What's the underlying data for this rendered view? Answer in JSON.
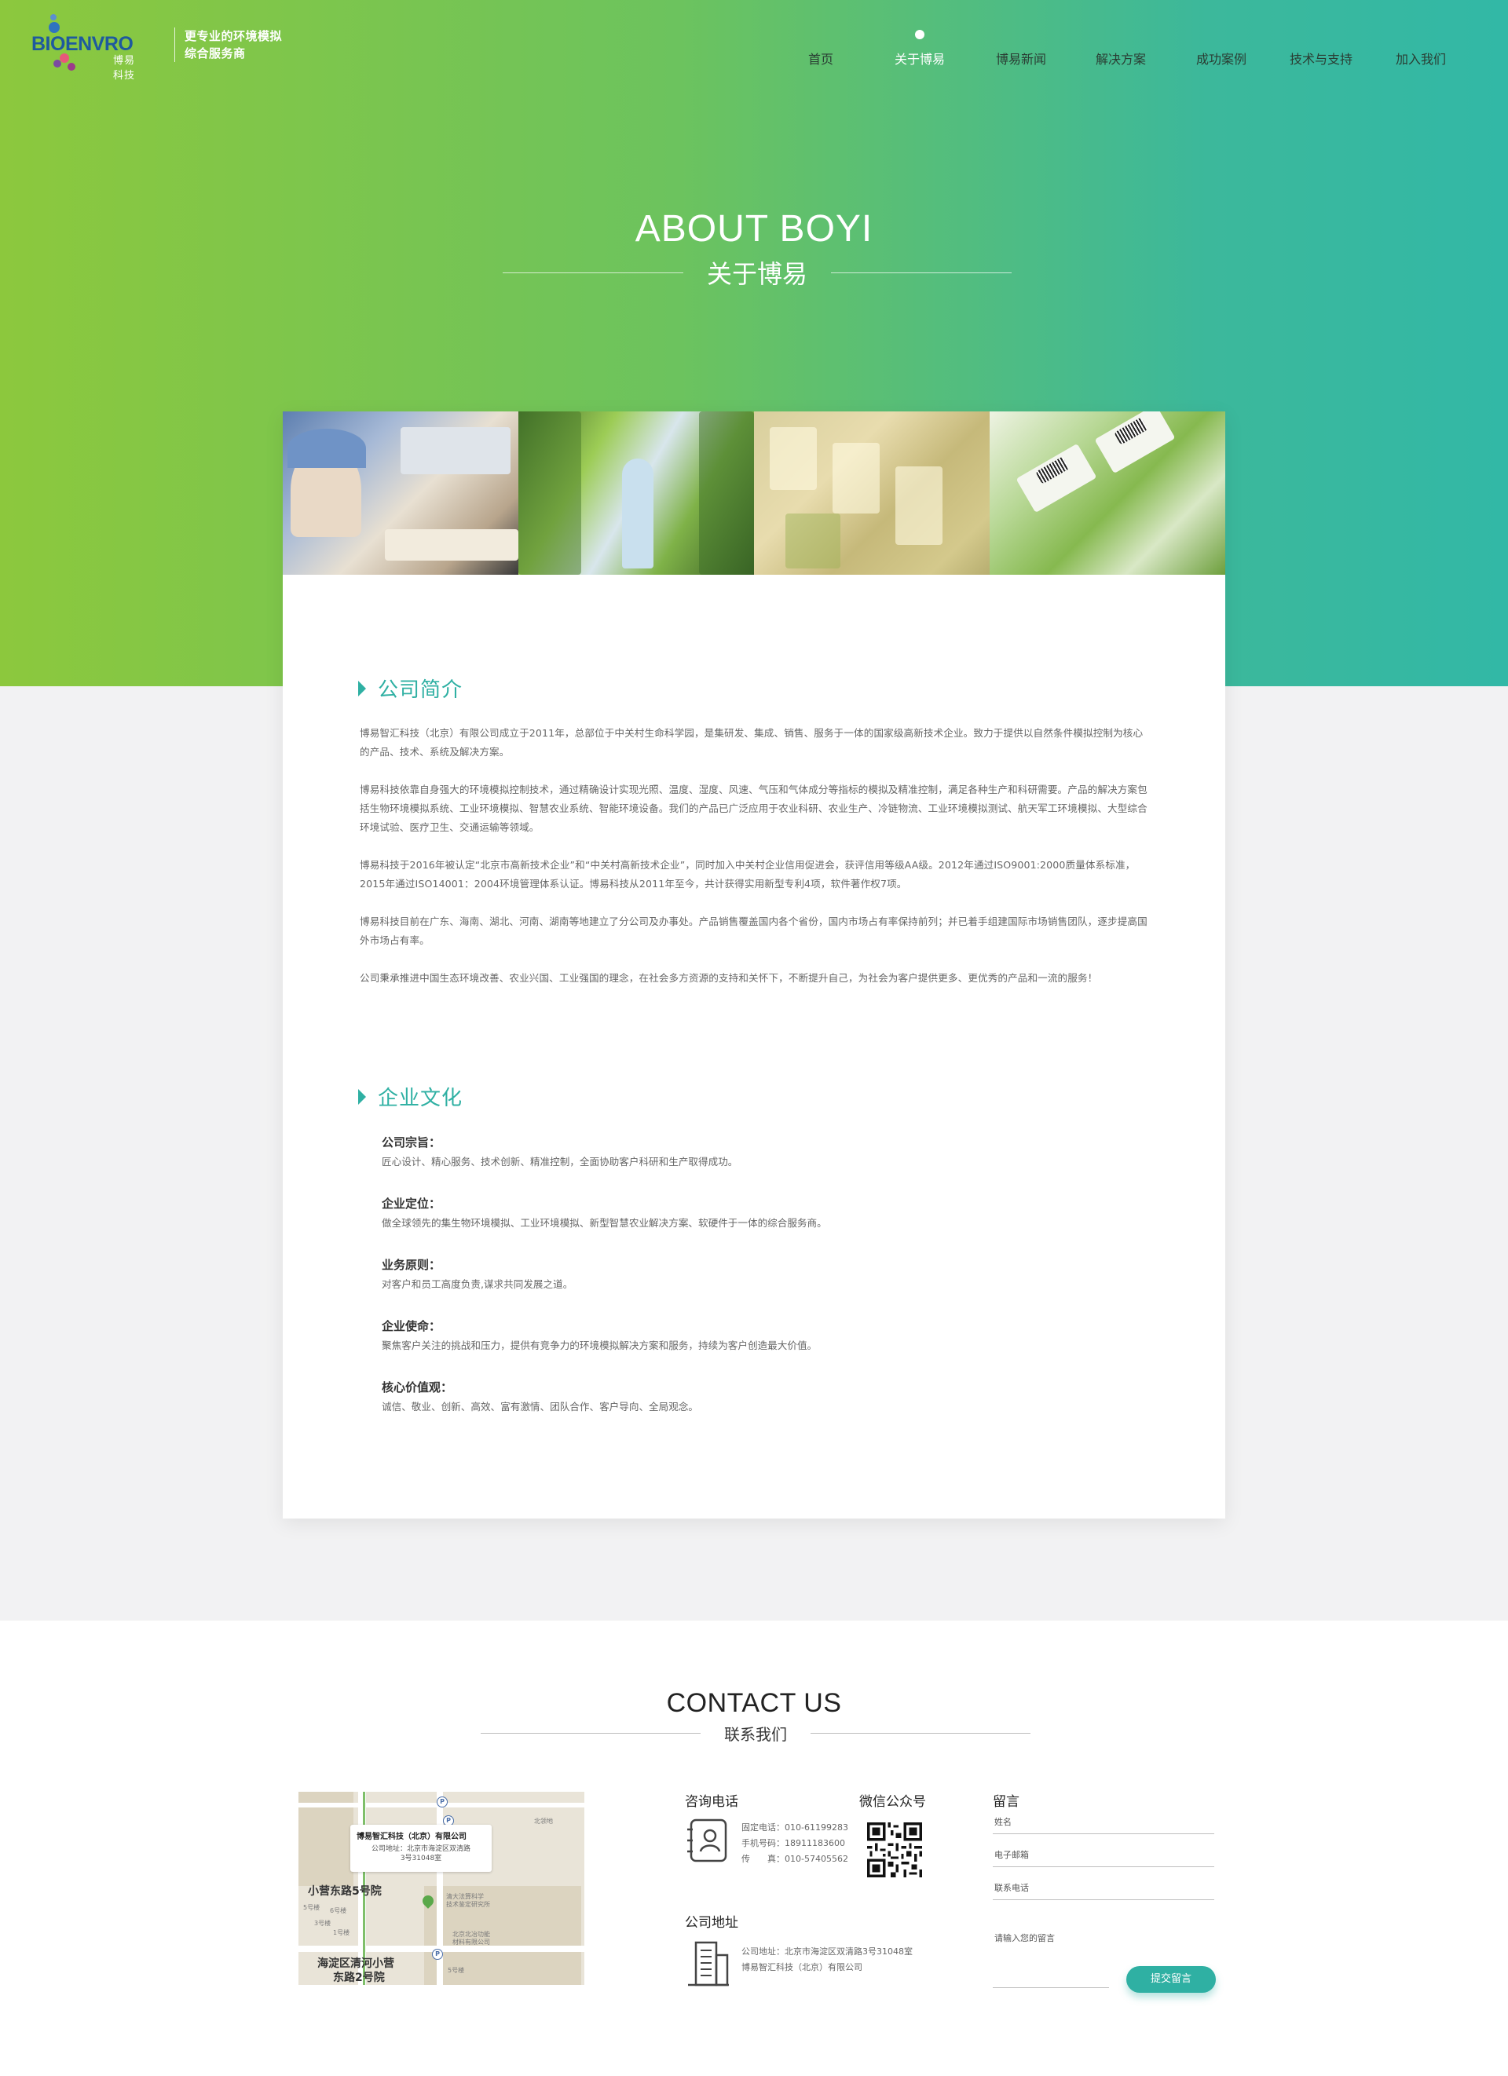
{
  "brand": {
    "logo_text": "BIOENVRO",
    "logo_cn": "博易科技",
    "slogan_line1": "更专业的环境模拟",
    "slogan_line2": "综合服务商"
  },
  "nav": {
    "items": [
      {
        "label": "首页"
      },
      {
        "label": "关于博易"
      },
      {
        "label": "博易新闻"
      },
      {
        "label": "解决方案"
      },
      {
        "label": "成功案例"
      },
      {
        "label": "技术与支持"
      },
      {
        "label": "加入我们"
      }
    ],
    "active_index": 1
  },
  "hero": {
    "title": "ABOUT BOYI",
    "subtitle": "关于博易"
  },
  "intro": {
    "heading": "公司简介",
    "paragraphs": [
      "博易智汇科技（北京）有限公司成立于2011年，总部位于中关村生命科学园，是集研发、集成、销售、服务于一体的国家级高新技术企业。致力于提供以自然条件模拟控制为核心的产品、技术、系统及解决方案。",
      "博易科技依靠自身强大的环境模拟控制技术，通过精确设计实现光照、温度、湿度、风速、气压和气体成分等指标的模拟及精准控制，满足各种生产和科研需要。产品的解决方案包括生物环境模拟系统、工业环境模拟、智慧农业系统、智能环境设备。我们的产品已广泛应用于农业科研、农业生产、冷链物流、工业环境模拟测试、航天军工环境模拟、大型综合环境试验、医疗卫生、交通运输等领域。",
      "博易科技于2016年被认定“北京市高新技术企业”和“中关村高新技术企业”，同时加入中关村企业信用促进会，获评信用等级AA级。2012年通过ISO9001:2000质量体系标准，2015年通过ISO14001：2004环境管理体系认证。博易科技从2011年至今，共计获得实用新型专利4项，软件著作权7项。",
      "博易科技目前在广东、海南、湖北、河南、湖南等地建立了分公司及办事处。产品销售覆盖国内各个省份，国内市场占有率保持前列；并已着手组建国际市场销售团队，逐步提高国外市场占有率。",
      "公司秉承推进中国生态环境改善、农业兴国、工业强国的理念，在社会多方资源的支持和关怀下，不断提升自己，为社会为客户提供更多、更优秀的产品和一流的服务！"
    ]
  },
  "culture": {
    "heading": "企业文化",
    "items": [
      {
        "title": "公司宗旨：",
        "text": "匠心设计、精心服务、技术创新、精准控制，全面协助客户科研和生产取得成功。"
      },
      {
        "title": "企业定位：",
        "text": "做全球领先的集生物环境模拟、工业环境模拟、新型智慧农业解决方案、软硬件于一体的综合服务商。"
      },
      {
        "title": "业务原则：",
        "text": "对客户和员工高度负责,谋求共同发展之道。"
      },
      {
        "title": "企业使命：",
        "text": "聚焦客户关注的挑战和压力，提供有竞争力的环境模拟解决方案和服务，持续为客户创造最大价值。"
      },
      {
        "title": "核心价值观：",
        "text": "诚信、敬业、创新、高效、富有激情、团队合作、客户导向、全局观念。"
      }
    ]
  },
  "contact": {
    "title": "CONTACT US",
    "subtitle": "联系我们",
    "map": {
      "popup_title": "博易智汇科技（北京）有限公司",
      "popup_addr1": "公司地址：北京市海淀区双清路",
      "popup_addr2": "3号31048室",
      "label_a": "小营东路5号院",
      "label_b": "海淀区清河小营",
      "label_c": "东路2号院",
      "poi_1": "北领地",
      "poi_2": "清大法算科学",
      "poi_3": "技术鉴定研究所",
      "poi_4": "北京北冶功能",
      "poi_5": "材料有限公司",
      "bldg_1": "5号楼",
      "bldg_2": "6号楼",
      "bldg_3": "3号楼",
      "bldg_4": "1号楼",
      "bldg_5": "5号楼"
    },
    "phone": {
      "title": "咨询电话",
      "landline": "固定电话：010-61199283",
      "mobile": "手机号码：18911183600",
      "fax": "传　　真：010-57405562"
    },
    "wechat": {
      "title": "微信公众号"
    },
    "address": {
      "title": "公司地址",
      "line1": "公司地址：北京市海淀区双清路3号31048室",
      "line2": "博易智汇科技（北京）有限公司"
    },
    "form": {
      "title": "留言",
      "name_label": "姓名",
      "email_label": "电子邮箱",
      "phone_label": "联系电话",
      "message_label": "请输入您的留言",
      "submit_label": "提交留言"
    }
  },
  "colors": {
    "gradient_start": "#8cc83d",
    "gradient_end": "#32b8a6",
    "accent": "#2fb0a3",
    "logo_blue": "#1e5a9e"
  }
}
